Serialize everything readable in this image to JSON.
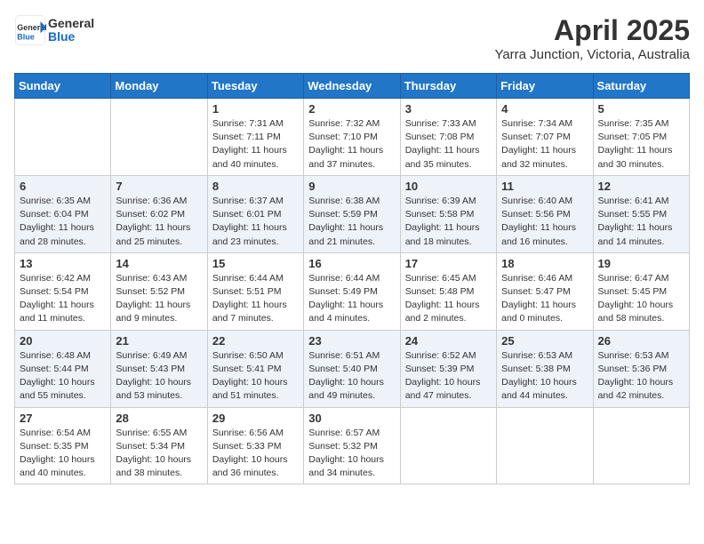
{
  "header": {
    "logo_general": "General",
    "logo_blue": "Blue",
    "month": "April 2025",
    "location": "Yarra Junction, Victoria, Australia"
  },
  "days_of_week": [
    "Sunday",
    "Monday",
    "Tuesday",
    "Wednesday",
    "Thursday",
    "Friday",
    "Saturday"
  ],
  "weeks": [
    [
      {
        "day": "",
        "sunrise": "",
        "sunset": "",
        "daylight": ""
      },
      {
        "day": "",
        "sunrise": "",
        "sunset": "",
        "daylight": ""
      },
      {
        "day": "1",
        "sunrise": "Sunrise: 7:31 AM",
        "sunset": "Sunset: 7:11 PM",
        "daylight": "Daylight: 11 hours and 40 minutes."
      },
      {
        "day": "2",
        "sunrise": "Sunrise: 7:32 AM",
        "sunset": "Sunset: 7:10 PM",
        "daylight": "Daylight: 11 hours and 37 minutes."
      },
      {
        "day": "3",
        "sunrise": "Sunrise: 7:33 AM",
        "sunset": "Sunset: 7:08 PM",
        "daylight": "Daylight: 11 hours and 35 minutes."
      },
      {
        "day": "4",
        "sunrise": "Sunrise: 7:34 AM",
        "sunset": "Sunset: 7:07 PM",
        "daylight": "Daylight: 11 hours and 32 minutes."
      },
      {
        "day": "5",
        "sunrise": "Sunrise: 7:35 AM",
        "sunset": "Sunset: 7:05 PM",
        "daylight": "Daylight: 11 hours and 30 minutes."
      }
    ],
    [
      {
        "day": "6",
        "sunrise": "Sunrise: 6:35 AM",
        "sunset": "Sunset: 6:04 PM",
        "daylight": "Daylight: 11 hours and 28 minutes."
      },
      {
        "day": "7",
        "sunrise": "Sunrise: 6:36 AM",
        "sunset": "Sunset: 6:02 PM",
        "daylight": "Daylight: 11 hours and 25 minutes."
      },
      {
        "day": "8",
        "sunrise": "Sunrise: 6:37 AM",
        "sunset": "Sunset: 6:01 PM",
        "daylight": "Daylight: 11 hours and 23 minutes."
      },
      {
        "day": "9",
        "sunrise": "Sunrise: 6:38 AM",
        "sunset": "Sunset: 5:59 PM",
        "daylight": "Daylight: 11 hours and 21 minutes."
      },
      {
        "day": "10",
        "sunrise": "Sunrise: 6:39 AM",
        "sunset": "Sunset: 5:58 PM",
        "daylight": "Daylight: 11 hours and 18 minutes."
      },
      {
        "day": "11",
        "sunrise": "Sunrise: 6:40 AM",
        "sunset": "Sunset: 5:56 PM",
        "daylight": "Daylight: 11 hours and 16 minutes."
      },
      {
        "day": "12",
        "sunrise": "Sunrise: 6:41 AM",
        "sunset": "Sunset: 5:55 PM",
        "daylight": "Daylight: 11 hours and 14 minutes."
      }
    ],
    [
      {
        "day": "13",
        "sunrise": "Sunrise: 6:42 AM",
        "sunset": "Sunset: 5:54 PM",
        "daylight": "Daylight: 11 hours and 11 minutes."
      },
      {
        "day": "14",
        "sunrise": "Sunrise: 6:43 AM",
        "sunset": "Sunset: 5:52 PM",
        "daylight": "Daylight: 11 hours and 9 minutes."
      },
      {
        "day": "15",
        "sunrise": "Sunrise: 6:44 AM",
        "sunset": "Sunset: 5:51 PM",
        "daylight": "Daylight: 11 hours and 7 minutes."
      },
      {
        "day": "16",
        "sunrise": "Sunrise: 6:44 AM",
        "sunset": "Sunset: 5:49 PM",
        "daylight": "Daylight: 11 hours and 4 minutes."
      },
      {
        "day": "17",
        "sunrise": "Sunrise: 6:45 AM",
        "sunset": "Sunset: 5:48 PM",
        "daylight": "Daylight: 11 hours and 2 minutes."
      },
      {
        "day": "18",
        "sunrise": "Sunrise: 6:46 AM",
        "sunset": "Sunset: 5:47 PM",
        "daylight": "Daylight: 11 hours and 0 minutes."
      },
      {
        "day": "19",
        "sunrise": "Sunrise: 6:47 AM",
        "sunset": "Sunset: 5:45 PM",
        "daylight": "Daylight: 10 hours and 58 minutes."
      }
    ],
    [
      {
        "day": "20",
        "sunrise": "Sunrise: 6:48 AM",
        "sunset": "Sunset: 5:44 PM",
        "daylight": "Daylight: 10 hours and 55 minutes."
      },
      {
        "day": "21",
        "sunrise": "Sunrise: 6:49 AM",
        "sunset": "Sunset: 5:43 PM",
        "daylight": "Daylight: 10 hours and 53 minutes."
      },
      {
        "day": "22",
        "sunrise": "Sunrise: 6:50 AM",
        "sunset": "Sunset: 5:41 PM",
        "daylight": "Daylight: 10 hours and 51 minutes."
      },
      {
        "day": "23",
        "sunrise": "Sunrise: 6:51 AM",
        "sunset": "Sunset: 5:40 PM",
        "daylight": "Daylight: 10 hours and 49 minutes."
      },
      {
        "day": "24",
        "sunrise": "Sunrise: 6:52 AM",
        "sunset": "Sunset: 5:39 PM",
        "daylight": "Daylight: 10 hours and 47 minutes."
      },
      {
        "day": "25",
        "sunrise": "Sunrise: 6:53 AM",
        "sunset": "Sunset: 5:38 PM",
        "daylight": "Daylight: 10 hours and 44 minutes."
      },
      {
        "day": "26",
        "sunrise": "Sunrise: 6:53 AM",
        "sunset": "Sunset: 5:36 PM",
        "daylight": "Daylight: 10 hours and 42 minutes."
      }
    ],
    [
      {
        "day": "27",
        "sunrise": "Sunrise: 6:54 AM",
        "sunset": "Sunset: 5:35 PM",
        "daylight": "Daylight: 10 hours and 40 minutes."
      },
      {
        "day": "28",
        "sunrise": "Sunrise: 6:55 AM",
        "sunset": "Sunset: 5:34 PM",
        "daylight": "Daylight: 10 hours and 38 minutes."
      },
      {
        "day": "29",
        "sunrise": "Sunrise: 6:56 AM",
        "sunset": "Sunset: 5:33 PM",
        "daylight": "Daylight: 10 hours and 36 minutes."
      },
      {
        "day": "30",
        "sunrise": "Sunrise: 6:57 AM",
        "sunset": "Sunset: 5:32 PM",
        "daylight": "Daylight: 10 hours and 34 minutes."
      },
      {
        "day": "",
        "sunrise": "",
        "sunset": "",
        "daylight": ""
      },
      {
        "day": "",
        "sunrise": "",
        "sunset": "",
        "daylight": ""
      },
      {
        "day": "",
        "sunrise": "",
        "sunset": "",
        "daylight": ""
      }
    ]
  ]
}
